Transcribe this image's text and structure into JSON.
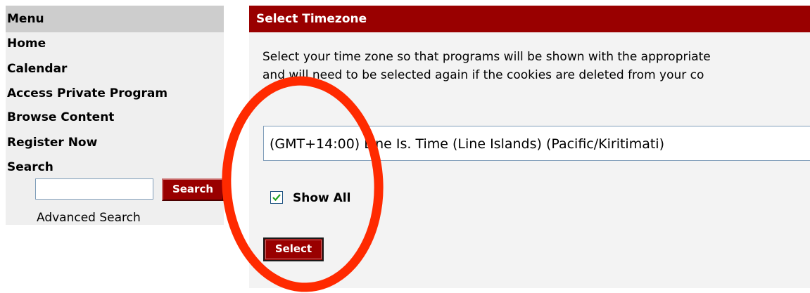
{
  "sidebar": {
    "header": "Menu",
    "items": [
      {
        "label": "Home"
      },
      {
        "label": "Calendar"
      },
      {
        "label": "Access Private Program"
      },
      {
        "label": "Browse Content"
      },
      {
        "label": "Register Now"
      },
      {
        "label": "Search"
      }
    ],
    "search": {
      "value": "",
      "placeholder": "",
      "button_label": "Search"
    },
    "advanced_search_label": "Advanced Search"
  },
  "panel": {
    "title": "Select Timezone",
    "description_line1": "Select your time zone so that programs will be shown with the appropriate",
    "description_line2": "and will need to be selected again if the cookies are deleted from your co",
    "timezone_select": {
      "selected": "(GMT+14:00) Line Is. Time (Line Islands) (Pacific/Kiritimati)"
    },
    "show_all": {
      "label": "Show All",
      "checked": true
    },
    "select_button_label": "Select"
  },
  "annotation": {
    "shape": "ellipse",
    "color": "#ff2a00"
  },
  "colors": {
    "brand_red": "#990000",
    "sidebar_bg": "#efefef",
    "sidebar_header_bg": "#cdcdcd",
    "panel_bg": "#f3f3f3"
  }
}
